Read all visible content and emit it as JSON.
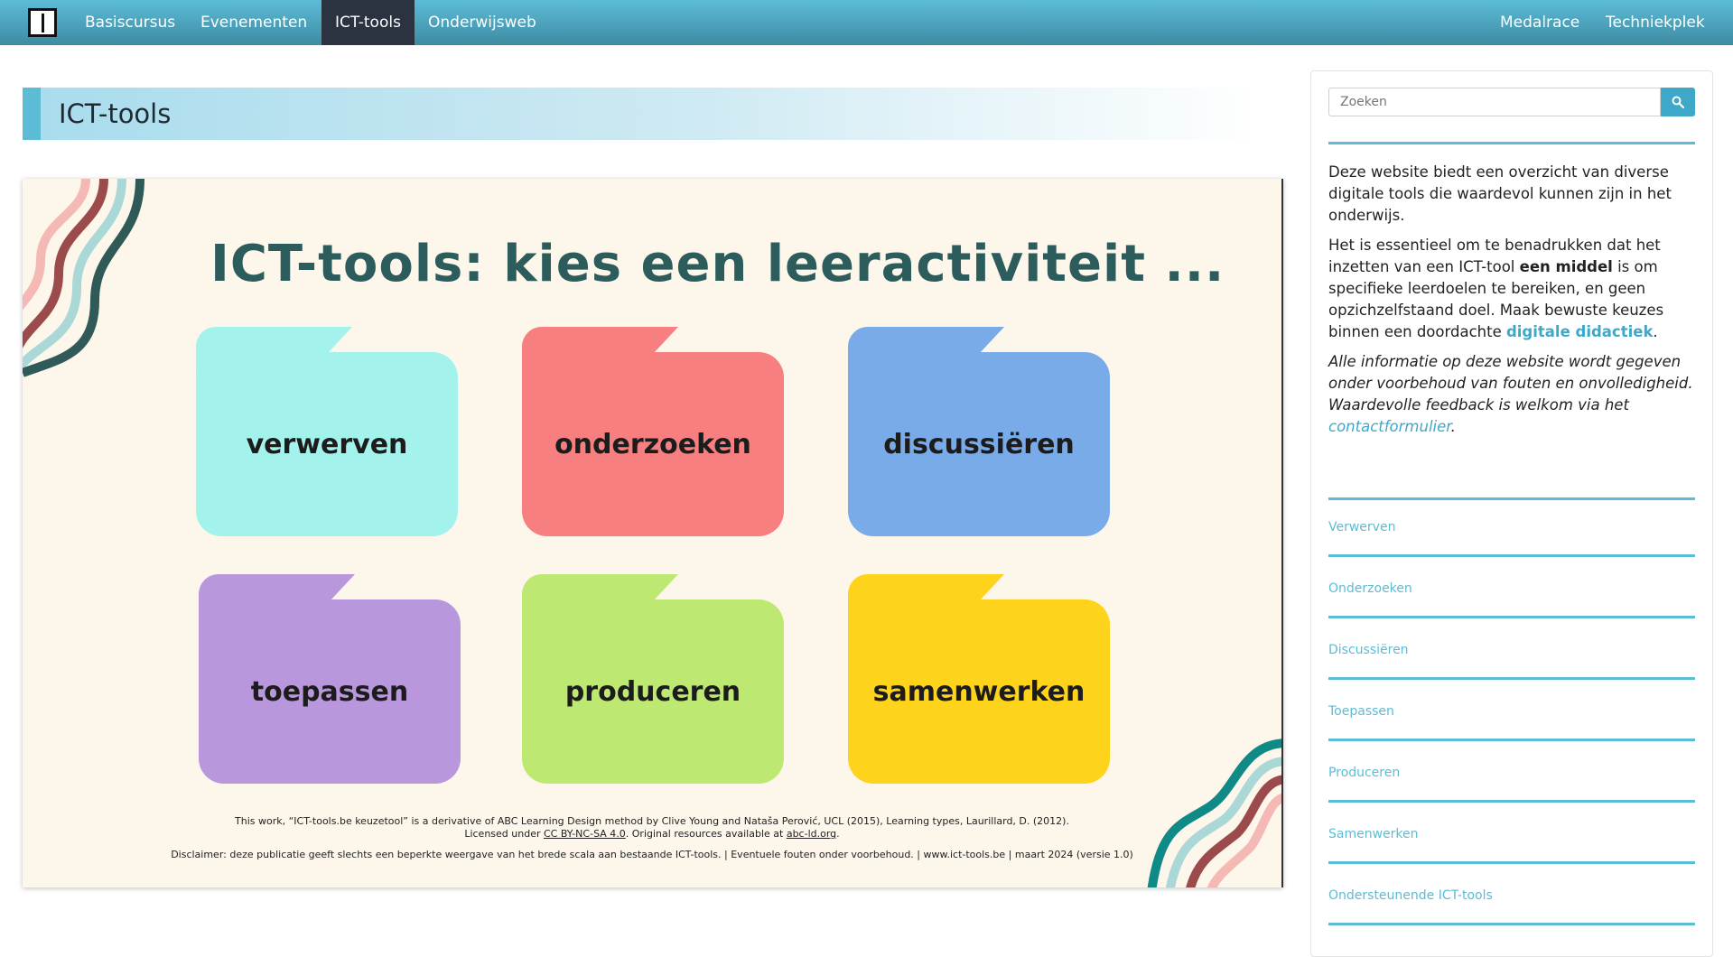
{
  "colors": {
    "nav_bg": "#4aa6c0",
    "nav_active_bg": "#2c3340",
    "accent": "#5cbcd6",
    "heading_teal": "#2c5c5c",
    "graphic_bg": "#fdf6eb"
  },
  "nav": {
    "logo_icon": "book-icon",
    "left": [
      {
        "label": "Basiscursus"
      },
      {
        "label": "Evenementen"
      },
      {
        "label": "ICT-tools",
        "active": true
      },
      {
        "label": "Onderwijsweb"
      }
    ],
    "right": [
      {
        "label": "Medalrace"
      },
      {
        "label": "Techniekplek"
      }
    ]
  },
  "page": {
    "title": "ICT-tools"
  },
  "graphic": {
    "heading": "ICT-tools: kies een leeractiviteit ...",
    "folders": [
      {
        "label": "verwerven",
        "color": "#a3f2ec"
      },
      {
        "label": "onderzoeken",
        "color": "#f77f7f"
      },
      {
        "label": "discussiëren",
        "color": "#79abe9"
      },
      {
        "label": "toepassen",
        "color": "#b997dd"
      },
      {
        "label": "produceren",
        "color": "#bde872"
      },
      {
        "label": "samenwerken",
        "color": "#fed31b"
      }
    ],
    "credit_line1": "This work, “ICT-tools.be keuzetool” is a derivative of ABC Learning Design method by Clive Young and Nataša Perović, UCL (2015), Learning types, Laurillard, D. (2012).",
    "credit_line2_a": "Licensed under ",
    "credit_license": "CC BY-NC-SA 4.0",
    "credit_line2_b": ". Original resources available at ",
    "credit_site": "abc-ld.org",
    "credit_line2_c": ".",
    "disclaimer": "Disclaimer: deze publicatie geeft slechts een beperkte weergave van het brede scala aan bestaande ICT-tools. | Eventuele fouten onder voorbehoud. | www.ict-tools.be | maart 2024 (versie 1.0)"
  },
  "sidebar": {
    "search_placeholder": "Zoeken",
    "search_icon": "search-icon",
    "p1": "Deze website biedt een overzicht van diverse digitale tools die waardevol kunnen zijn in het onderwijs.",
    "p2_a": "Het is essentieel om te benadrukken dat het inzetten van een ICT-tool ",
    "p2_bold": "een middel",
    "p2_b": " is om specifieke leerdoelen te bereiken, en geen opzichzelfstaand doel. Maak bewuste keuzes binnen een doordachte ",
    "p2_link": "digitale didactiek",
    "p2_c": ".",
    "p3_a": "Alle informatie op deze website wordt gegeven onder voorbehoud van fouten en onvolledigheid. Waardevolle feedback is welkom via het ",
    "p3_link": "contactformulier",
    "p3_b": ".",
    "links": [
      {
        "label": "Verwerven"
      },
      {
        "label": "Onderzoeken"
      },
      {
        "label": "Discussiëren"
      },
      {
        "label": "Toepassen"
      },
      {
        "label": "Produceren"
      },
      {
        "label": "Samenwerken"
      },
      {
        "label": "Ondersteunende ICT-tools"
      }
    ]
  }
}
